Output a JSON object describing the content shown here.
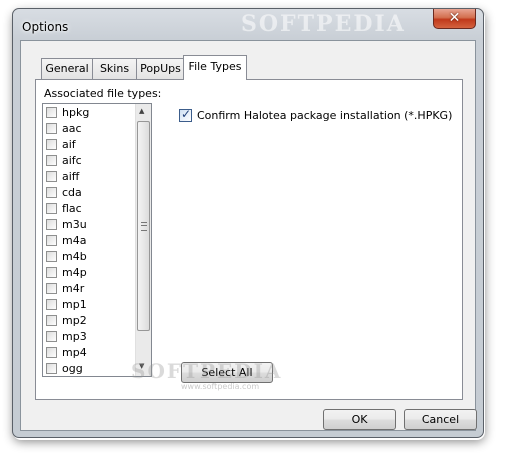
{
  "window": {
    "title": "Options",
    "close_glyph": "✕",
    "watermark": "SOFTPEDIA",
    "watermark_sub": "www.softpedia.com"
  },
  "tabs": [
    {
      "label": "General",
      "active": false
    },
    {
      "label": "Skins",
      "active": false
    },
    {
      "label": "PopUps",
      "active": false
    },
    {
      "label": "File Types",
      "active": true
    }
  ],
  "file_types": {
    "list_label": "Associated file types:",
    "items": [
      {
        "label": "hpkg",
        "checked": false
      },
      {
        "label": "aac",
        "checked": false
      },
      {
        "label": "aif",
        "checked": false
      },
      {
        "label": "aifc",
        "checked": false
      },
      {
        "label": "aiff",
        "checked": false
      },
      {
        "label": "cda",
        "checked": false
      },
      {
        "label": "flac",
        "checked": false
      },
      {
        "label": "m3u",
        "checked": false
      },
      {
        "label": "m4a",
        "checked": false
      },
      {
        "label": "m4b",
        "checked": false
      },
      {
        "label": "m4p",
        "checked": false
      },
      {
        "label": "m4r",
        "checked": false
      },
      {
        "label": "mp1",
        "checked": false
      },
      {
        "label": "mp2",
        "checked": false
      },
      {
        "label": "mp3",
        "checked": false
      },
      {
        "label": "mp4",
        "checked": false
      },
      {
        "label": "ogg",
        "checked": false
      }
    ],
    "confirm_label": "Confirm Halotea package installation (*.HPKG)",
    "confirm_checked": true,
    "select_all_label": "Select All"
  },
  "footer": {
    "ok_label": "OK",
    "cancel_label": "Cancel"
  },
  "icons": {
    "scroll_up": "▲",
    "scroll_down": "▼",
    "check": "✓"
  }
}
